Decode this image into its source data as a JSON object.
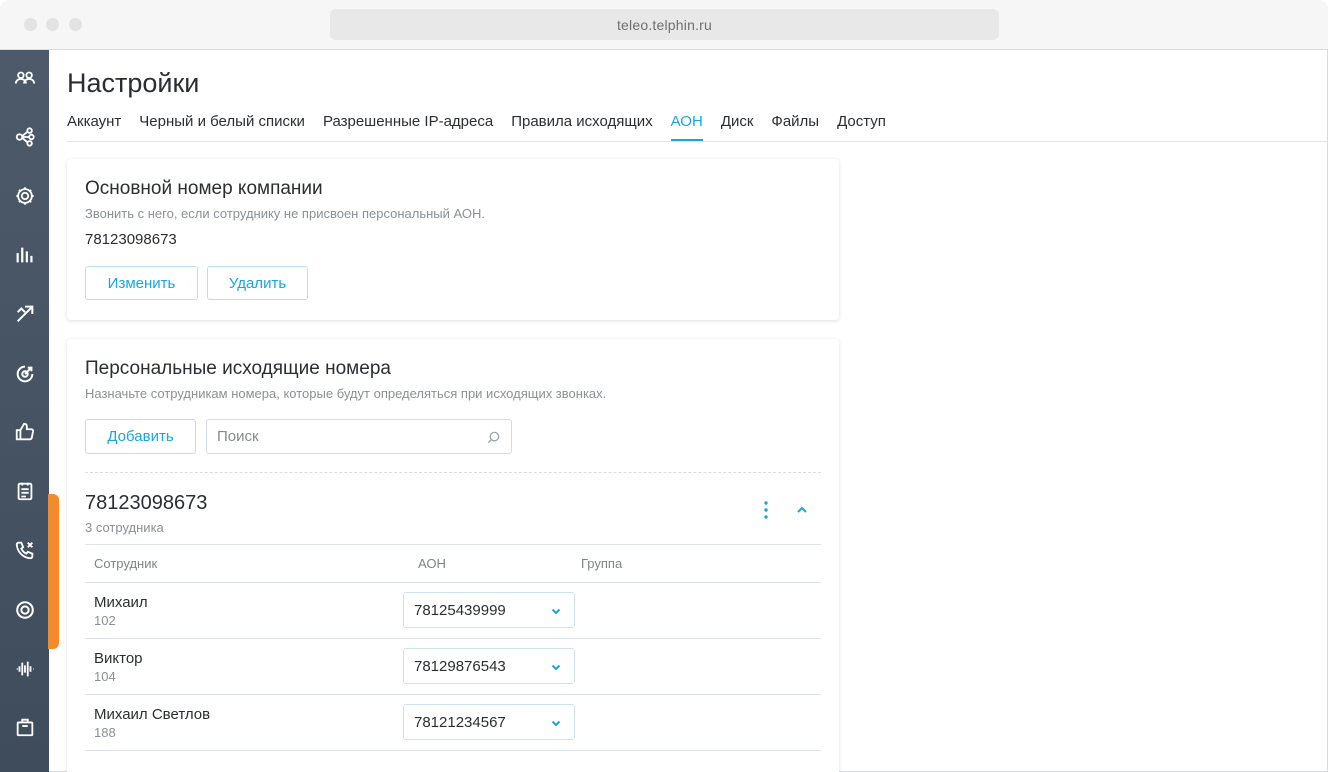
{
  "browser": {
    "url": "teleo.telphin.ru"
  },
  "rail": {
    "items": [
      {
        "name": "users-icon"
      },
      {
        "name": "routing-icon"
      },
      {
        "name": "settings-icon"
      },
      {
        "name": "stats-icon"
      },
      {
        "name": "calls-transfer-icon"
      },
      {
        "name": "target-icon"
      },
      {
        "name": "thumbs-up-icon"
      },
      {
        "name": "notes-icon"
      },
      {
        "name": "missed-call-icon"
      },
      {
        "name": "record-icon"
      },
      {
        "name": "audio-wave-icon"
      },
      {
        "name": "bag-icon"
      }
    ]
  },
  "page": {
    "title": "Настройки"
  },
  "tabs": [
    {
      "label": "Аккаунт"
    },
    {
      "label": "Черный и белый списки"
    },
    {
      "label": "Разрешенные IP-адреса"
    },
    {
      "label": "Правила исходящих"
    },
    {
      "label": "АОН",
      "active": true
    },
    {
      "label": "Диск"
    },
    {
      "label": "Файлы"
    },
    {
      "label": "Доступ"
    }
  ],
  "main_number": {
    "title": "Основной номер компании",
    "subtitle": "Звонить с него, если сотруднику не присвоен персональный АОН.",
    "value": "78123098673",
    "edit_label": "Изменить",
    "delete_label": "Удалить"
  },
  "personal": {
    "title": "Персональные исходящие номера",
    "subtitle": "Назначьте сотрудникам номера, которые будут определяться при исходящих звонках.",
    "add_label": "Добавить",
    "search_placeholder": "Поиск",
    "group": {
      "number": "78123098673",
      "count": "3 сотрудника",
      "columns": {
        "employee": "Сотрудник",
        "aon": "АОН",
        "group": "Группа"
      },
      "rows": [
        {
          "name": "Михаил",
          "ext": "102",
          "aon": "78125439999"
        },
        {
          "name": "Виктор",
          "ext": "104",
          "aon": "78129876543"
        },
        {
          "name": "Михаил Светлов",
          "ext": "188",
          "aon": "78121234567"
        }
      ]
    }
  },
  "colors": {
    "accent": "#1aa6d8",
    "rail": "#465464",
    "rail_active": "#f28a2e"
  }
}
